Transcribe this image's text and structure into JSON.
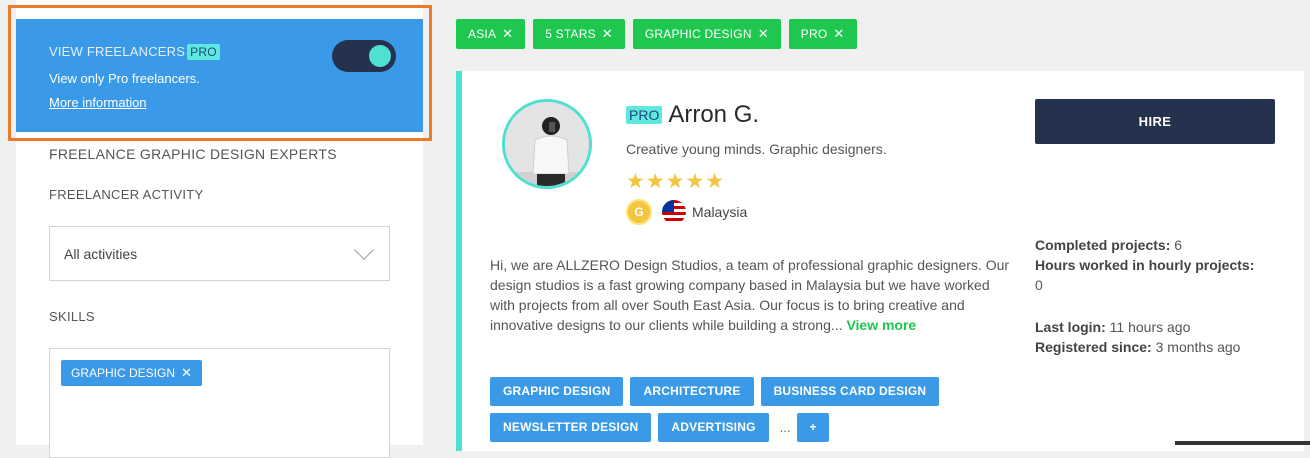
{
  "pro_panel": {
    "title": "VIEW FREELANCERS",
    "badge": "PRO",
    "description": "View only Pro freelancers.",
    "link": "More information",
    "toggle_on": true
  },
  "sidebar": {
    "heading": "FREELANCE GRAPHIC DESIGN EXPERTS",
    "activity_label": "FREELANCER ACTIVITY",
    "activity_value": "All activities",
    "skills_label": "SKILLS",
    "skills_selected": [
      "GRAPHIC DESIGN"
    ]
  },
  "filters": [
    "ASIA",
    "5 STARS",
    "GRAPHIC DESIGN",
    "PRO"
  ],
  "freelancer": {
    "badge": "PRO",
    "name": "Arron G.",
    "tagline": "Creative young minds. Graphic designers.",
    "stars": "★★★★★",
    "rating": 5,
    "level_badge": "G",
    "country": "Malaysia",
    "bio": "Hi, we are ALLZERO Design Studios, a team of professional graphic designers. Our design studios is a fast growing company based in Malaysia but we have worked with projects from all over South East Asia. Our focus is to bring creative and innovative designs to our clients while building a strong...",
    "view_more": "View more",
    "hire_label": "HIRE",
    "stats": {
      "completed_label": "Completed projects:",
      "completed_value": "6",
      "hours_label": "Hours worked in hourly projects:",
      "hours_value": "0",
      "last_login_label": "Last login:",
      "last_login_value": "11 hours ago",
      "registered_label": "Registered since:",
      "registered_value": "3 months ago"
    },
    "tags_row1": [
      "GRAPHIC DESIGN",
      "ARCHITECTURE",
      "BUSINESS CARD DESIGN"
    ],
    "tags_row2": [
      "NEWSLETTER DESIGN",
      "ADVERTISING"
    ],
    "more_ellipsis": "...",
    "more_button": "+"
  },
  "colors": {
    "pro_blue": "#3b9ae8",
    "accent_teal": "#4fe0d2",
    "filter_green": "#1ec74e",
    "navy": "#25324e",
    "highlight_orange": "#e87c2a"
  }
}
